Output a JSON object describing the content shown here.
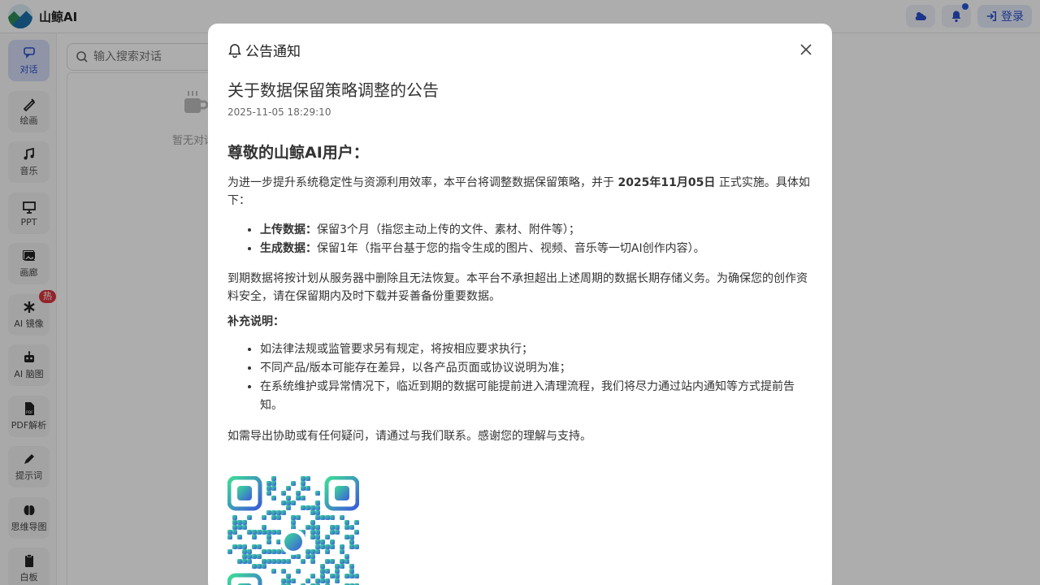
{
  "app": {
    "brand_name": "山鲸AI",
    "login_label": "登录"
  },
  "sidebar": {
    "items": [
      {
        "label": "对话",
        "icon": "chat-icon"
      },
      {
        "label": "绘画",
        "icon": "brush-icon"
      },
      {
        "label": "音乐",
        "icon": "music-icon"
      },
      {
        "label": "PPT",
        "icon": "presentation-icon"
      },
      {
        "label": "画廊",
        "icon": "gallery-icon"
      },
      {
        "label": "AI 镜像",
        "icon": "asterisk-icon",
        "badge": "热"
      },
      {
        "label": "AI 脑图",
        "icon": "robot-icon"
      },
      {
        "label": "PDF解析",
        "icon": "pdf-icon"
      },
      {
        "label": "提示词",
        "icon": "pen-icon"
      },
      {
        "label": "思维导图",
        "icon": "brain-icon"
      },
      {
        "label": "白板",
        "icon": "clipboard-icon"
      }
    ]
  },
  "conversations": {
    "search_placeholder": "输入搜索对话",
    "empty_text": "暂无对话"
  },
  "modal": {
    "header_title": "公告通知",
    "notice_title": "关于数据保留策略调整的公告",
    "notice_time": "2025-11-05 18:29:10",
    "greeting": "尊敬的山鲸AI用户：",
    "intro_before": "为进一步提升系统稳定性与资源利用效率，本平台将调整数据保留策略，并于 ",
    "intro_date": "2025年11月05日",
    "intro_after": " 正式实施。具体如下：",
    "retention": [
      {
        "label": "上传数据：",
        "text": "保留3个月（指您主动上传的文件、素材、附件等）；"
      },
      {
        "label": "生成数据：",
        "text": "保留1年（指平台基于您的指令生成的图片、视频、音乐等一切AI创作内容）。"
      }
    ],
    "expiry_note": "到期数据将按计划从服务器中删除且无法恢复。本平台不承担超出上述周期的数据长期存储义务。为确保您的创作资料安全，请在保留期内及时下载并妥善备份重要数据。",
    "supplement_heading": "补充说明：",
    "supplement_items": [
      "如法律法规或监管要求另有规定，将按相应要求执行；",
      "不同产品/版本可能存在差异，以各产品页面或协议说明为准；",
      "在系统维护或异常情况下，临近到期的数据可能提前进入清理流程，我们将尽力通过站内通知等方式提前告知。"
    ],
    "closing": "如需导出协助或有任何疑问，请通过与我们联系。感谢您的理解与支持。"
  },
  "colors": {
    "accent": "#2a4fc9",
    "active_bg": "#d3dcf6",
    "badge": "#d9363e",
    "qr_start": "#3ddc97",
    "qr_end": "#3b5bdb"
  }
}
